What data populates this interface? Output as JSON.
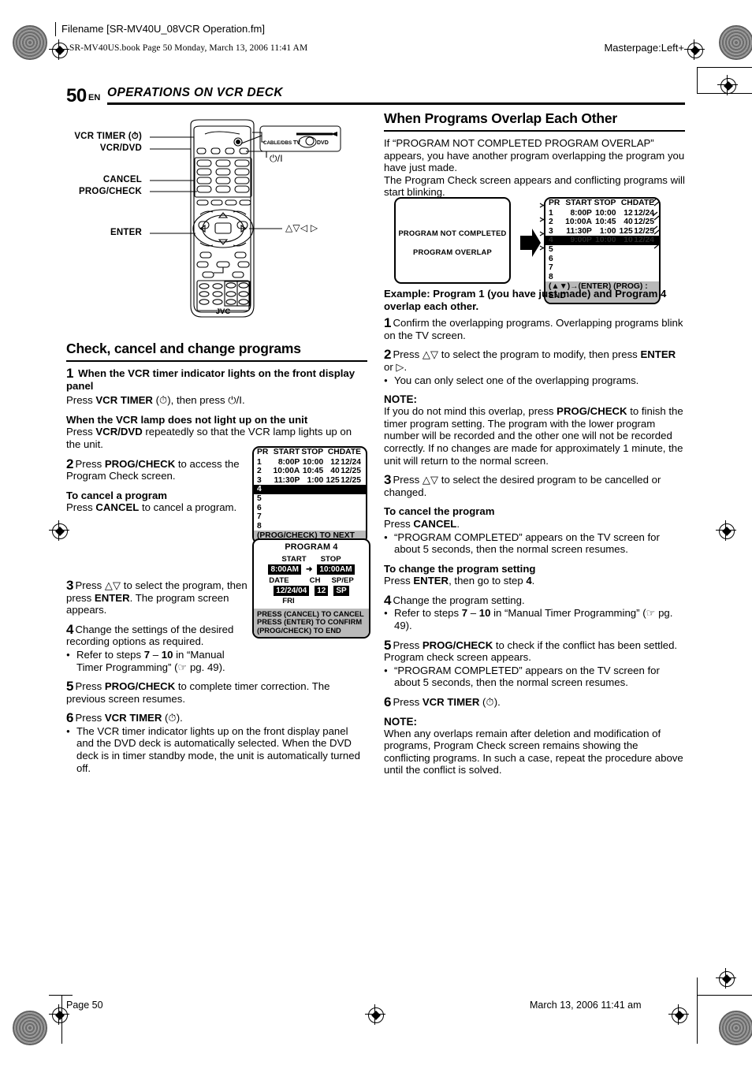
{
  "slug": {
    "filename": "Filename [SR-MV40U_08VCR Operation.fm]",
    "book_line": "SR-MV40US.book  Page 50  Monday, March 13, 2006  11:41 AM",
    "masterpage": "Masterpage:Left+"
  },
  "header": {
    "page_number": "50",
    "lang": "EN",
    "title": "OPERATIONS ON VCR DECK"
  },
  "remote": {
    "labels": {
      "vcr_timer": "VCR TIMER (⏱)",
      "vcr_dvd": "VCR/DVD",
      "cancel": "CANCEL",
      "prog_check": "PROG/CHECK",
      "enter": "ENTER",
      "power": "⏻/I",
      "dpad": "△▽◁ ▷"
    },
    "selector": {
      "cable_dbs": "CABLE/DBS",
      "tv": "TV",
      "dvd": "DVD"
    },
    "brand": "JVC"
  },
  "left": {
    "section_title": "Check, cancel and change programs",
    "step1": {
      "num": "1",
      "heading": "When the VCR timer indicator lights on the front display panel",
      "body_pre": "Press ",
      "body_bold": "VCR TIMER",
      "body_post": " (⏱), then press ⏻/I."
    },
    "sub_lamp": {
      "heading": "When the VCR lamp does not light up on the unit",
      "body_pre": "Press ",
      "body_bold": "VCR/DVD",
      "body_post": " repeatedly so that the VCR lamp lights up on the unit."
    },
    "step2": {
      "num": "2",
      "pre": "Press ",
      "bold": "PROG/CHECK",
      "post": " to access the Program Check screen."
    },
    "cancel_block": {
      "heading": "To cancel a program",
      "pre": "Press ",
      "bold": "CANCEL",
      "post": " to cancel a program."
    },
    "step3": {
      "num": "3",
      "pre": "Press △▽ to select the program, then press ",
      "bold": "ENTER",
      "post": ". The program screen appears."
    },
    "step4": {
      "num": "4",
      "text": "Change the settings of the desired recording options as required.",
      "bullet_a": "Refer to steps ",
      "bullet_b": "7",
      "bullet_c": " – ",
      "bullet_d": "10",
      "bullet_e": " in “Manual Timer Programming” (☞ pg. 49)."
    },
    "step5": {
      "num": "5",
      "pre": "Press ",
      "bold": "PROG/CHECK",
      "post": " to complete timer correction. The previous screen resumes."
    },
    "step6": {
      "num": "6",
      "pre": "Press ",
      "bold": "VCR TIMER",
      "post": " (⏱).",
      "bullet": "The VCR timer indicator lights up on the front display panel and the DVD deck is automatically selected. When the DVD deck is in timer standby mode, the unit is automatically turned off."
    }
  },
  "osd_check_left": {
    "headers": [
      "PR",
      "START",
      "STOP",
      "CH",
      "DATE"
    ],
    "rows": [
      [
        "1",
        "8:00P",
        "10:00",
        "12",
        "12/24"
      ],
      [
        "2",
        "10:00A",
        "10:45",
        "40",
        "12/25"
      ],
      [
        "3",
        "11:30P",
        "1:00",
        "125",
        "12/25"
      ]
    ],
    "selected_row": "4",
    "empty_rows": [
      "5",
      "6",
      "7",
      "8"
    ],
    "footer": "(PROG/CHECK) TO NEXT"
  },
  "osd_program4": {
    "title": "PROGRAM 4",
    "start_label": "START",
    "stop_label": "STOP",
    "start_value": "8:00AM",
    "stop_value": "10:00AM",
    "date_label": "DATE",
    "ch_label": "CH",
    "mode_label": "SP/EP",
    "date_value": "12/24/04",
    "ch_value": "12",
    "mode_value": "SP",
    "day_value": "FRI",
    "footer_lines": [
      "PRESS (CANCEL) TO CANCEL",
      "PRESS (ENTER) TO CONFIRM",
      "(PROG/CHECK) TO END"
    ]
  },
  "right": {
    "section_title": "When Programs Overlap Each Other",
    "intro_p1": "If “PROGRAM NOT COMPLETED PROGRAM OVERLAP” appears, you have another program overlapping the program you have just made.",
    "intro_p2": "The Program Check screen appears and conflicting programs will start blinking.",
    "example": "Example: Program 1 (you have just made) and Program 4 overlap each other.",
    "step1": {
      "num": "1",
      "text": "Confirm the overlapping programs. Overlapping programs blink on the TV screen."
    },
    "step2": {
      "num": "2",
      "pre": "Press △▽ to select the program to modify, then press ",
      "bold": "ENTER",
      "post": " or ▷.",
      "bullet": "You can only select one of the overlapping programs."
    },
    "note1_hd": "NOTE:",
    "note1_pre": "If you do not mind this overlap, press ",
    "note1_bold": "PROG/CHECK",
    "note1_post": " to finish the timer program setting. The program with the lower program number will be recorded and the other one will not be recorded correctly. If no changes are made for approximately 1 minute, the unit will return to the normal screen.",
    "step3": {
      "num": "3",
      "text": "Press △▽ to select the desired program to be cancelled or changed."
    },
    "cancel_block": {
      "heading": "To cancel the program",
      "pre": "Press ",
      "bold": "CANCEL",
      "post": ".",
      "bullet": "“PROGRAM COMPLETED” appears on the TV screen for about 5 seconds, then the normal screen resumes."
    },
    "change_block": {
      "heading": "To change the program setting",
      "pre": "Press ",
      "bold": "ENTER",
      "mid": ", then go to step ",
      "bold2": "4",
      "post": "."
    },
    "step4": {
      "num": "4",
      "text": "Change the program setting.",
      "bullet_a": "Refer to steps ",
      "bullet_b": "7",
      "bullet_c": " – ",
      "bullet_d": "10",
      "bullet_e": " in “Manual Timer Programming” (☞ pg. 49)."
    },
    "step5": {
      "num": "5",
      "pre": "Press ",
      "bold": "PROG/CHECK",
      "post": " to check if the conflict has been settled. Program check screen appears.",
      "bullet": "“PROGRAM COMPLETED” appears on the TV screen for about 5 seconds, then the normal screen resumes."
    },
    "step6": {
      "num": "6",
      "pre": "Press ",
      "bold": "VCR TIMER",
      "post": " (⏱)."
    },
    "note2_hd": "NOTE:",
    "note2_body": "When any overlaps remain after deletion and modification of programs, Program Check screen remains showing the conflicting programs. In such a case, repeat the procedure above until the conflict is solved."
  },
  "osd_overlap_msg": {
    "line1": "PROGRAM NOT COMPLETED",
    "line2": "PROGRAM OVERLAP"
  },
  "osd_check_right": {
    "headers": [
      "PR",
      "START",
      "STOP",
      "CH",
      "DATE"
    ],
    "rows": [
      [
        "1",
        "8:00P",
        "10:00",
        "12",
        "12/24"
      ],
      [
        "2",
        "10:00A",
        "10:45",
        "40",
        "12/25"
      ],
      [
        "3",
        "11:30P",
        "1:00",
        "125",
        "12/25"
      ]
    ],
    "blink_row": [
      "4",
      "9:00P",
      "10:00",
      "10",
      "12/24"
    ],
    "empty_rows": [
      "5",
      "6",
      "7",
      "8"
    ],
    "footer": "(▲▼)→(ENTER) (PROG) : END"
  },
  "footer": {
    "page": "Page 50",
    "date": "March 13, 2006 11:41 am"
  }
}
